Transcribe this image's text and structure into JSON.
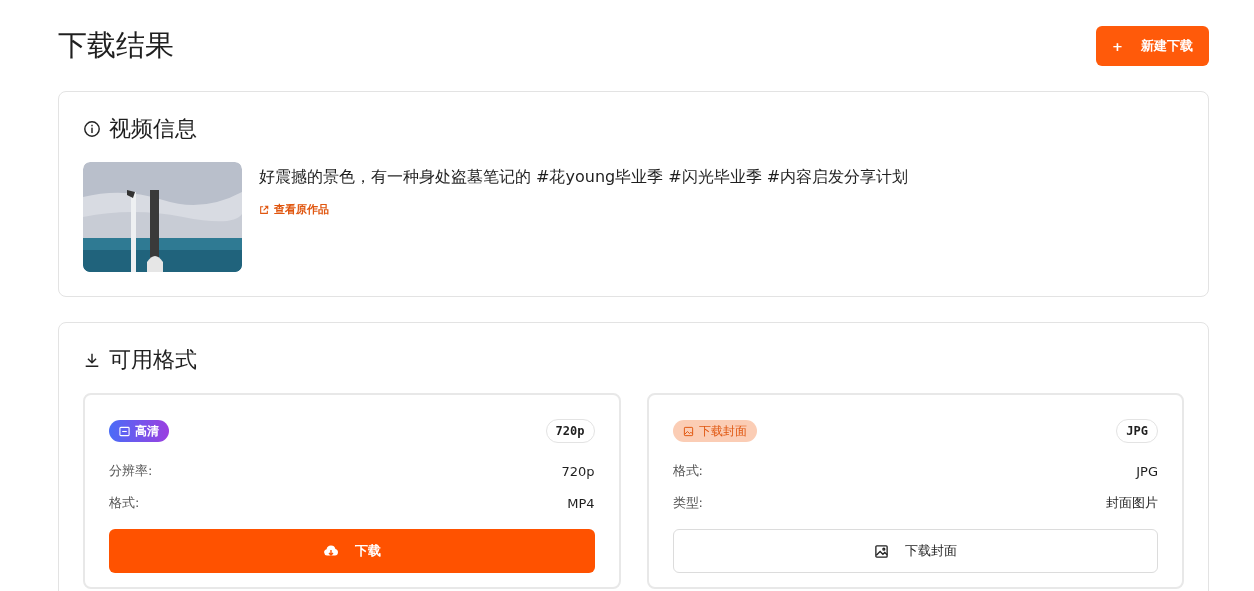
{
  "page_title": "下载结果",
  "new_download_button": {
    "icon": "+",
    "label": "新建下载"
  },
  "video_info": {
    "heading": "视频信息",
    "description": "好震撼的景色，有一种身处盗墓笔记的 #花young毕业季 #闪光毕业季 #内容启发分享计划",
    "original_link": "查看原作品"
  },
  "formats": {
    "heading": "可用格式",
    "items": [
      {
        "kind": "video",
        "badge": "高清",
        "tag": "720p",
        "fields": [
          {
            "label": "分辨率:",
            "value": "720p"
          },
          {
            "label": "格式:",
            "value": "MP4"
          }
        ],
        "button": "下载"
      },
      {
        "kind": "cover",
        "badge": "下载封面",
        "tag": "JPG",
        "fields": [
          {
            "label": "格式:",
            "value": "JPG"
          },
          {
            "label": "类型:",
            "value": "封面图片"
          }
        ],
        "button": "下载封面"
      }
    ]
  }
}
